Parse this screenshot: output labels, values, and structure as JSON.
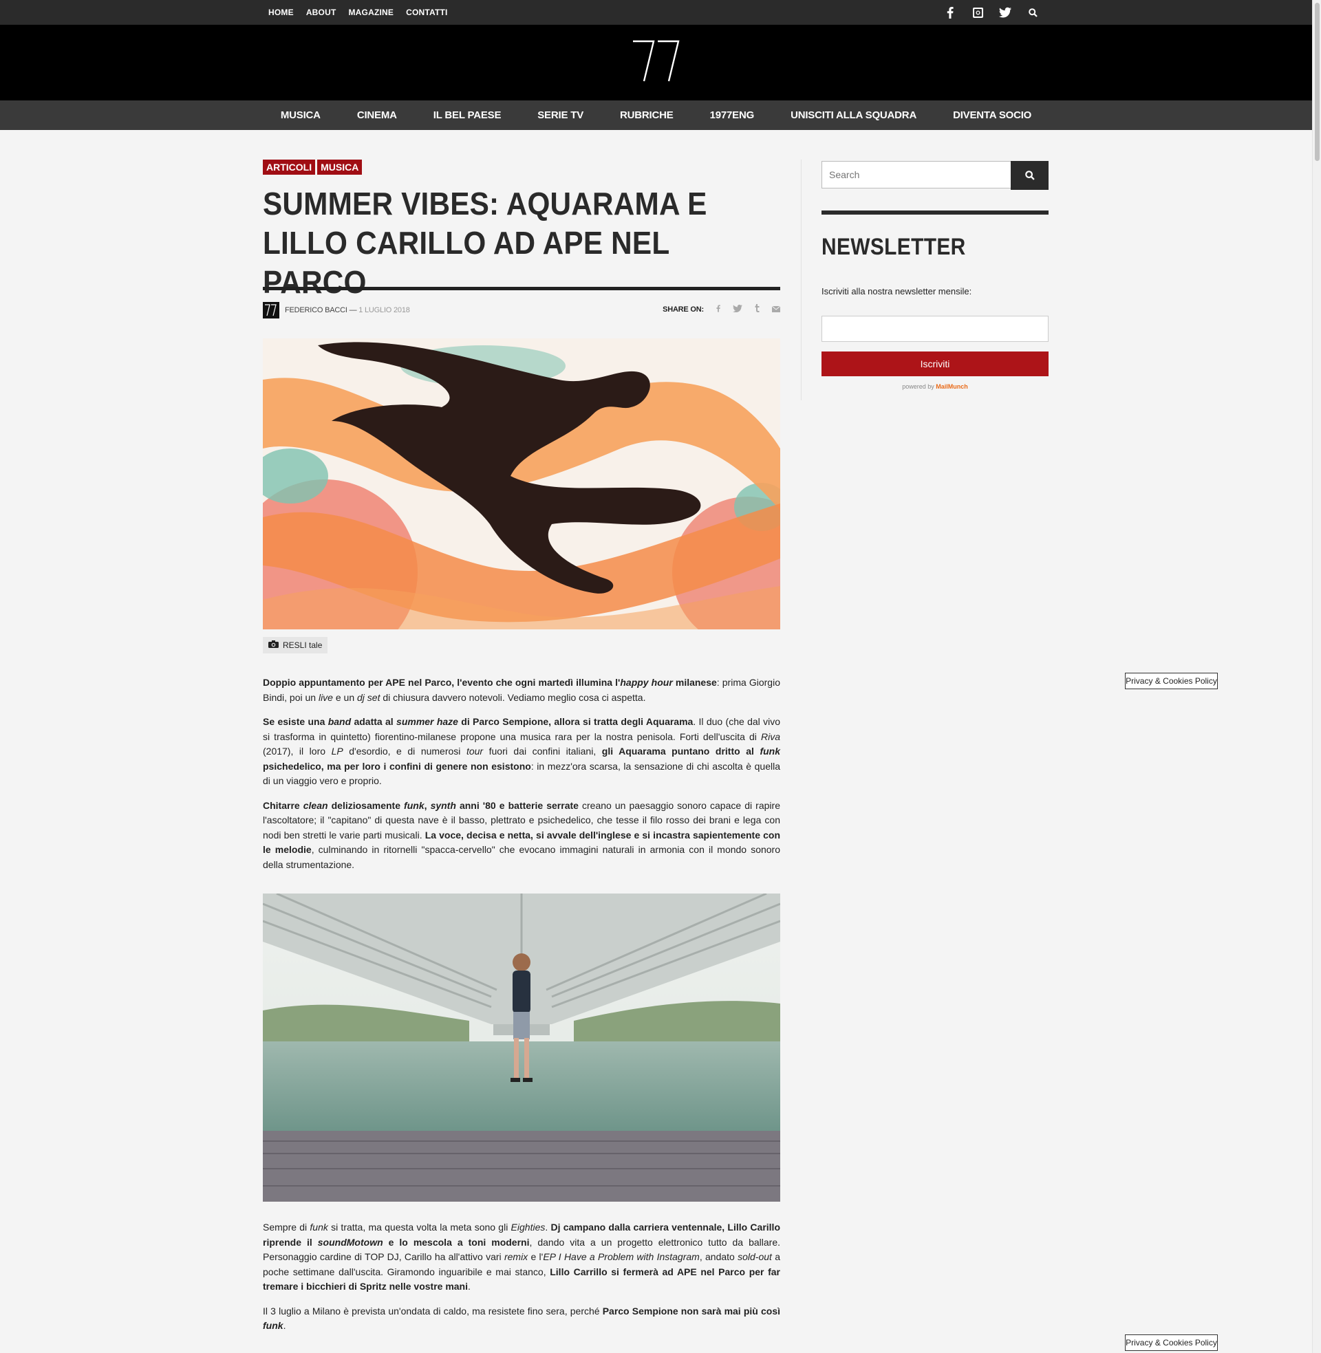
{
  "topnav": [
    "HOME",
    "ABOUT",
    "MAGAZINE",
    "CONTATTI"
  ],
  "social_icons": [
    "facebook-icon",
    "instagram-icon",
    "twitter-icon",
    "search-icon"
  ],
  "logo_text": "77",
  "mainnav": [
    "MUSICA",
    "CINEMA",
    "IL BEL PAESE",
    "SERIE TV",
    "RUBRICHE",
    "1977ENG",
    "UNISCITI ALLA SQUADRA",
    "DIVENTA SOCIO"
  ],
  "article": {
    "categories": [
      "ARTICOLI",
      "MUSICA"
    ],
    "title": "SUMMER VIBES: AQUARAMA E LILLO CARILLO AD APE NEL PARCO",
    "author": "FEDERICO BACCI",
    "date": "1 LUGLIO 2018",
    "share_label": "SHARE ON:",
    "photo_credit": "RESLI tale",
    "p1a": "Doppio appuntamento per APE nel Parco, l'evento che ogni martedì illumina l'",
    "p1b": "happy hour",
    "p1c": " milanese",
    "p1d": ": prima Giorgio Bindi, poi un ",
    "p1e": "live",
    "p1f": " e un ",
    "p1g": "dj set",
    "p1h": " di chiusura davvero notevoli. Vediamo meglio cosa ci aspetta.",
    "p2a": "Se esiste una ",
    "p2b": "band",
    "p2c": " adatta al ",
    "p2d": "summer haze",
    "p2e": " di Parco Sempione, allora si tratta degli Aquarama",
    "p2f": ". Il duo (che dal vivo si trasforma in quintetto) fiorentino-milanese propone una musica rara per la nostra penisola. Forti dell'uscita di ",
    "p2g": "Riva",
    "p2h": " (2017), il loro ",
    "p2i": "LP",
    "p2j": " d'esordio, e di numerosi ",
    "p2k": "tour",
    "p2l": " fuori dai confini italiani, ",
    "p2m": "gli Aquarama puntano dritto al ",
    "p2n": "funk",
    "p2o": " psichedelico, ma per loro i confini di genere non esistono",
    "p2p": ": in mezz'ora scarsa, la sensazione di chi ascolta è quella di un viaggio vero e proprio.",
    "p3a": "Chitarre ",
    "p3b": "clean",
    "p3c": " deliziosamente ",
    "p3d": "funk",
    "p3e": ", ",
    "p3f": "synth",
    "p3g": " anni '80 e batterie serrate",
    "p3h": " creano un paesaggio sonoro capace di rapire l'ascoltatore; il \"capitano\" di questa nave è il basso, plettrato e psichedelico, che tesse il filo rosso dei brani e lega con nodi ben stretti le varie parti musicali. ",
    "p3i": "La voce, decisa e netta, si avvale dell'inglese e si incastra sapientemente con le melodie",
    "p3j": ", culminando in ritornelli \"spacca-cervello\" che evocano immagini naturali in armonia con il mondo sonoro della strumentazione.",
    "p4a": "Sempre di ",
    "p4b": "funk",
    "p4c": " si tratta, ma questa volta la meta sono gli ",
    "p4d": "Eighties",
    "p4e": ". ",
    "p4f": "Dj campano dalla carriera ventennale, Lillo Carillo riprende il ",
    "p4g": "sound",
    "p4h": "Motown",
    "p4i": " e lo mescola a toni moderni",
    "p4j": ", dando vita a un progetto elettronico tutto da ballare. Personaggio cardine di TOP DJ, Carillo ha all'attivo vari ",
    "p4k": "remix",
    "p4l": " e l'",
    "p4m": "EP I Have a Problem with Instagram",
    "p4n": ", andato ",
    "p4o": "sold-out",
    "p4p": " a poche settimane dall'uscita. Giramondo inguaribile e mai stanco, ",
    "p4q": "Lillo Carrillo si fermerà ad APE nel Parco per far tremare i bicchieri di Spritz nelle vostre mani",
    "p4r": ".",
    "p5a": "Il 3 luglio a Milano è prevista un'ondata di caldo, ma resistete fino sera, perché ",
    "p5b": "Parco Sempione non sarà mai più così ",
    "p5c": "funk",
    "p5d": "."
  },
  "sidebar": {
    "search_placeholder": "Search",
    "newsletter_title": "NEWSLETTER",
    "newsletter_sub": "Iscriviti alla nostra newsletter mensile:",
    "subscribe_label": "Iscriviti",
    "powered_prefix": "powered by ",
    "powered_brand": "MailMunch"
  },
  "privacy_label": "Privacy & Cookies Policy",
  "colors": {
    "accent": "#a00e14",
    "button": "#ad1418",
    "topbar": "#2b2b2b",
    "mainnav": "#3a3a3a"
  }
}
